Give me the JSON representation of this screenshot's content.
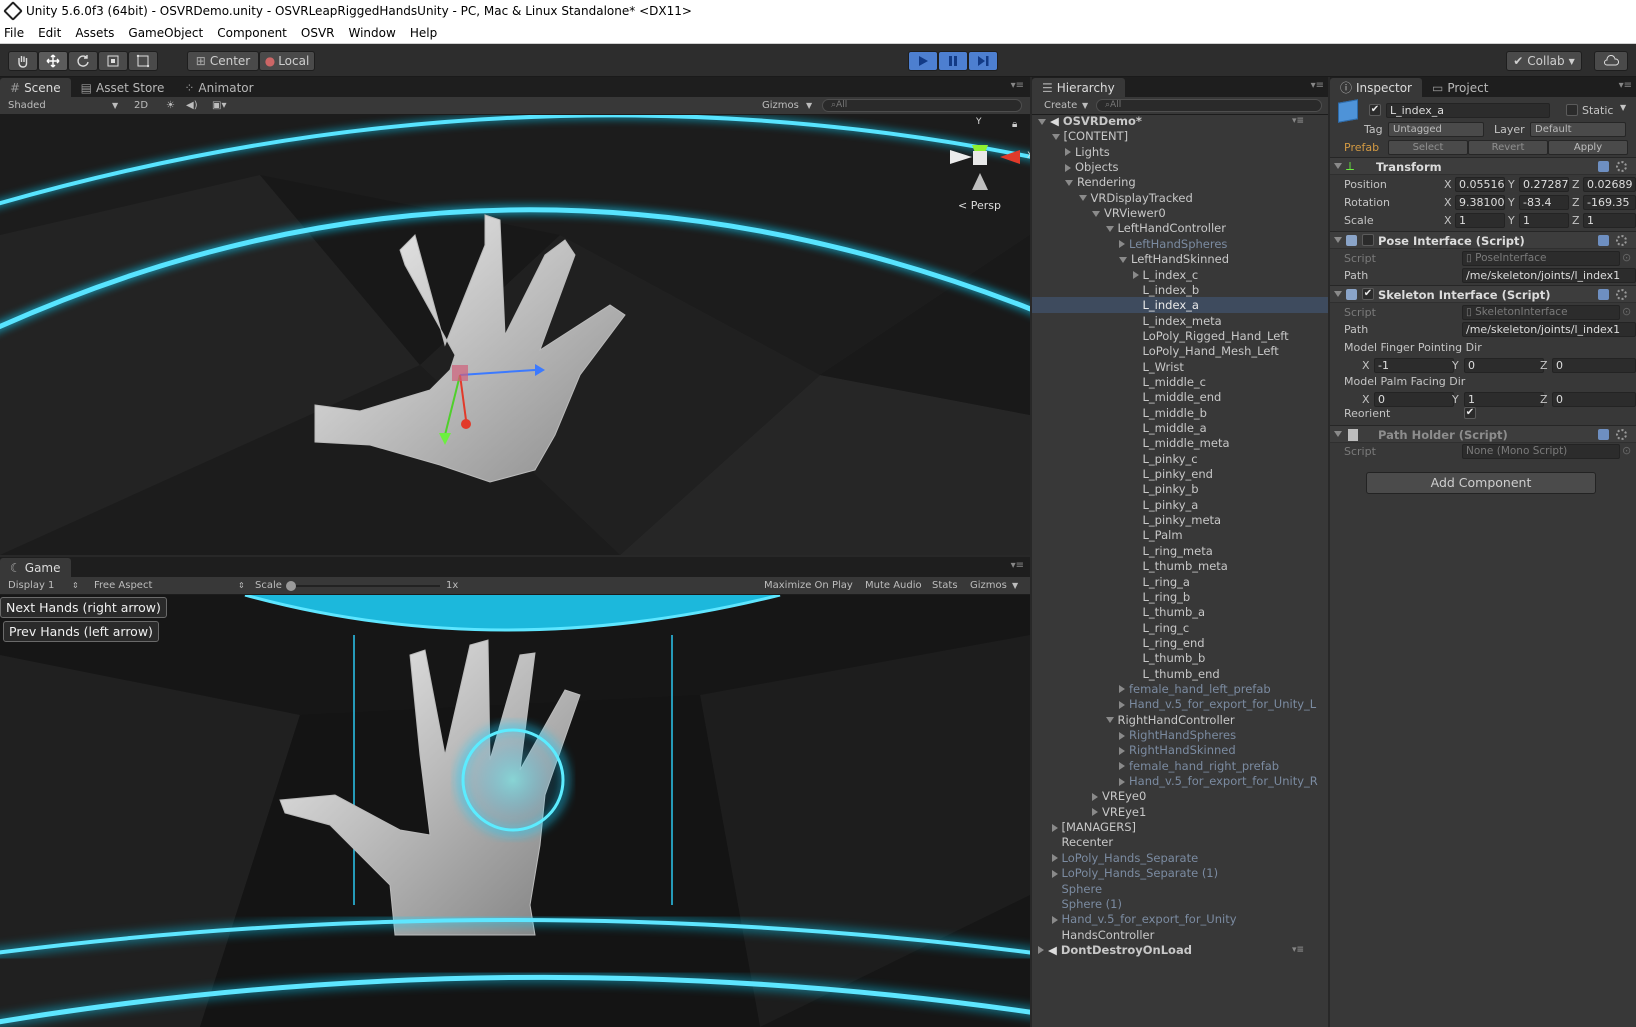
{
  "window": {
    "title": "Unity 5.6.0f3 (64bit) - OSVRDemo.unity - OSVRLeapRiggedHandsUnity - PC, Mac & Linux Standalone* <DX11>"
  },
  "menu": [
    "File",
    "Edit",
    "Assets",
    "GameObject",
    "Component",
    "OSVR",
    "Window",
    "Help"
  ],
  "toolbar": {
    "pivot": "Center",
    "space": "Local",
    "collab": "Collab"
  },
  "scene": {
    "tabs": [
      "Scene",
      "Asset Store",
      "Animator"
    ],
    "shading": "Shaded",
    "mode2d": "2D",
    "gizmos": "Gizmos",
    "search_placeholder": "All",
    "persp": "Persp",
    "axis_y": "Y",
    "axis_x": "X"
  },
  "game": {
    "tab": "Game",
    "display": "Display 1",
    "aspect": "Free Aspect",
    "scale_label": "Scale",
    "scale_value": "1x",
    "maximize": "Maximize On Play",
    "mute": "Mute Audio",
    "stats": "Stats",
    "gizmos": "Gizmos",
    "next_button": "Next Hands (right arrow)",
    "prev_button": "Prev Hands (left arrow)"
  },
  "hierarchy": {
    "tab": "Hierarchy",
    "create": "Create",
    "search_placeholder": "All",
    "rows": [
      {
        "label": "OSVRDemo*",
        "arrow": "d",
        "indent": 0,
        "style": "scene"
      },
      {
        "label": "[CONTENT]",
        "arrow": "d",
        "indent": 1,
        "style": ""
      },
      {
        "label": "Lights",
        "arrow": "r",
        "indent": 2,
        "style": ""
      },
      {
        "label": "Objects",
        "arrow": "r",
        "indent": 2,
        "style": ""
      },
      {
        "label": "Rendering",
        "arrow": "d",
        "indent": 2,
        "style": ""
      },
      {
        "label": "VRDisplayTracked",
        "arrow": "d",
        "indent": 3,
        "style": ""
      },
      {
        "label": "VRViewer0",
        "arrow": "d",
        "indent": 4,
        "style": ""
      },
      {
        "label": "LeftHandController",
        "arrow": "d",
        "indent": 5,
        "style": ""
      },
      {
        "label": "LeftHandSpheres",
        "arrow": "r",
        "indent": 6,
        "style": "dim"
      },
      {
        "label": "LeftHandSkinned",
        "arrow": "d",
        "indent": 6,
        "style": ""
      },
      {
        "label": "L_index_c",
        "arrow": "r",
        "indent": 7,
        "style": ""
      },
      {
        "label": "L_index_b",
        "arrow": "",
        "indent": 7,
        "style": ""
      },
      {
        "label": "L_index_a",
        "arrow": "",
        "indent": 7,
        "style": "sel"
      },
      {
        "label": "L_index_meta",
        "arrow": "",
        "indent": 7,
        "style": ""
      },
      {
        "label": "LoPoly_Rigged_Hand_Left",
        "arrow": "",
        "indent": 7,
        "style": ""
      },
      {
        "label": "LoPoly_Hand_Mesh_Left",
        "arrow": "",
        "indent": 7,
        "style": ""
      },
      {
        "label": "L_Wrist",
        "arrow": "",
        "indent": 7,
        "style": ""
      },
      {
        "label": "L_middle_c",
        "arrow": "",
        "indent": 7,
        "style": ""
      },
      {
        "label": "L_middle_end",
        "arrow": "",
        "indent": 7,
        "style": ""
      },
      {
        "label": "L_middle_b",
        "arrow": "",
        "indent": 7,
        "style": ""
      },
      {
        "label": "L_middle_a",
        "arrow": "",
        "indent": 7,
        "style": ""
      },
      {
        "label": "L_middle_meta",
        "arrow": "",
        "indent": 7,
        "style": ""
      },
      {
        "label": "L_pinky_c",
        "arrow": "",
        "indent": 7,
        "style": ""
      },
      {
        "label": "L_pinky_end",
        "arrow": "",
        "indent": 7,
        "style": ""
      },
      {
        "label": "L_pinky_b",
        "arrow": "",
        "indent": 7,
        "style": ""
      },
      {
        "label": "L_pinky_a",
        "arrow": "",
        "indent": 7,
        "style": ""
      },
      {
        "label": "L_pinky_meta",
        "arrow": "",
        "indent": 7,
        "style": ""
      },
      {
        "label": "L_Palm",
        "arrow": "",
        "indent": 7,
        "style": ""
      },
      {
        "label": "L_ring_meta",
        "arrow": "",
        "indent": 7,
        "style": ""
      },
      {
        "label": "L_thumb_meta",
        "arrow": "",
        "indent": 7,
        "style": ""
      },
      {
        "label": "L_ring_a",
        "arrow": "",
        "indent": 7,
        "style": ""
      },
      {
        "label": "L_ring_b",
        "arrow": "",
        "indent": 7,
        "style": ""
      },
      {
        "label": "L_thumb_a",
        "arrow": "",
        "indent": 7,
        "style": ""
      },
      {
        "label": "L_ring_c",
        "arrow": "",
        "indent": 7,
        "style": ""
      },
      {
        "label": "L_ring_end",
        "arrow": "",
        "indent": 7,
        "style": ""
      },
      {
        "label": "L_thumb_b",
        "arrow": "",
        "indent": 7,
        "style": ""
      },
      {
        "label": "L_thumb_end",
        "arrow": "",
        "indent": 7,
        "style": ""
      },
      {
        "label": "female_hand_left_prefab",
        "arrow": "r",
        "indent": 6,
        "style": "dim"
      },
      {
        "label": "Hand_v.5_for_export_for_Unity_L",
        "arrow": "r",
        "indent": 6,
        "style": "dim"
      },
      {
        "label": "RightHandController",
        "arrow": "d",
        "indent": 5,
        "style": ""
      },
      {
        "label": "RightHandSpheres",
        "arrow": "r",
        "indent": 6,
        "style": "dim"
      },
      {
        "label": "RightHandSkinned",
        "arrow": "r",
        "indent": 6,
        "style": "dim"
      },
      {
        "label": "female_hand_right_prefab",
        "arrow": "r",
        "indent": 6,
        "style": "dim"
      },
      {
        "label": "Hand_v.5_for_export_for_Unity_R",
        "arrow": "r",
        "indent": 6,
        "style": "dim"
      },
      {
        "label": "VREye0",
        "arrow": "r",
        "indent": 4,
        "style": ""
      },
      {
        "label": "VREye1",
        "arrow": "r",
        "indent": 4,
        "style": ""
      },
      {
        "label": "[MANAGERS]",
        "arrow": "r",
        "indent": 1,
        "style": ""
      },
      {
        "label": "Recenter",
        "arrow": "",
        "indent": 1,
        "style": ""
      },
      {
        "label": "LoPoly_Hands_Separate",
        "arrow": "r",
        "indent": 1,
        "style": "dim"
      },
      {
        "label": "LoPoly_Hands_Separate (1)",
        "arrow": "r",
        "indent": 1,
        "style": "dim"
      },
      {
        "label": "Sphere",
        "arrow": "",
        "indent": 1,
        "style": "dim"
      },
      {
        "label": "Sphere (1)",
        "arrow": "",
        "indent": 1,
        "style": "dim"
      },
      {
        "label": "Hand_v.5_for_export_for_Unity",
        "arrow": "r",
        "indent": 1,
        "style": "dim"
      },
      {
        "label": "HandsController",
        "arrow": "",
        "indent": 1,
        "style": ""
      },
      {
        "label": "DontDestroyOnLoad",
        "arrow": "r",
        "indent": 0,
        "style": "scene"
      }
    ]
  },
  "inspector": {
    "tabs": [
      "Inspector",
      "Project"
    ],
    "object_name": "L_index_a",
    "static_label": "Static",
    "tag_label": "Tag",
    "tag_value": "Untagged",
    "layer_label": "Layer",
    "layer_value": "Default",
    "prefab_label": "Prefab",
    "prefab_select": "Select",
    "prefab_revert": "Revert",
    "prefab_apply": "Apply",
    "transform": {
      "title": "Transform",
      "position_label": "Position",
      "rotation_label": "Rotation",
      "scale_label": "Scale",
      "position": [
        "0.05516",
        "0.27287",
        "0.02689"
      ],
      "rotation": [
        "9.38100",
        "-83.4",
        "-169.35"
      ],
      "scale": [
        "1",
        "1",
        "1"
      ]
    },
    "pose": {
      "title": "Pose Interface (Script)",
      "script_label": "Script",
      "script_value": "PoseInterface",
      "path_label": "Path",
      "path_value": "/me/skeleton/joints/l_index1"
    },
    "skeleton": {
      "title": "Skeleton Interface (Script)",
      "script_label": "Script",
      "script_value": "SkeletonInterface",
      "path_label": "Path",
      "path_value": "/me/skeleton/joints/l_index1",
      "finger_dir_label": "Model Finger Pointing Dir",
      "finger_dir": [
        "-1",
        "0",
        "0"
      ],
      "palm_dir_label": "Model Palm Facing Dir",
      "palm_dir": [
        "0",
        "1",
        "0"
      ],
      "reorient_label": "Reorient"
    },
    "pathholder": {
      "title": "Path Holder (Script)",
      "script_label": "Script",
      "script_value": "None (Mono Script)"
    },
    "add_component": "Add Component",
    "axis_labels": [
      "X",
      "Y",
      "Z"
    ]
  }
}
